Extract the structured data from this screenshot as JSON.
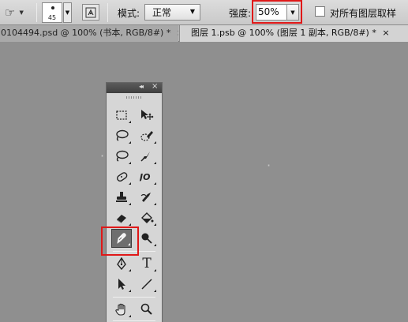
{
  "options_bar": {
    "brush_size": "45",
    "mode_label": "模式:",
    "mode_value": "正常",
    "strength_label": "强度:",
    "strength_value": "50%",
    "sample_all_layers_label": "对所有图层取样",
    "sample_all_layers_checked": false,
    "highlight_color": "#e01818"
  },
  "tabs": [
    {
      "label": "0104494.psd @ 100% (书本, RGB/8#) *",
      "active": false,
      "close": "×"
    },
    {
      "label": "图层 1.psb @ 100% (图层 1 副本, RGB/8#) *",
      "active": true,
      "close": "×"
    }
  ],
  "toolbox": {
    "collapse_glyph": "◂◂",
    "close_glyph": "×",
    "active_tool": "smudge-tool",
    "tools": [
      {
        "name": "marquee-tool",
        "icon": "dashed-rectangle"
      },
      {
        "name": "move-tool",
        "icon": "move-arrow"
      },
      {
        "name": "lasso-tool",
        "icon": "lasso"
      },
      {
        "name": "quick-selection-tool",
        "icon": "quick-select-brush"
      },
      {
        "name": "lasso-tool-2",
        "icon": "lasso"
      },
      {
        "name": "crop-tool",
        "icon": "crop"
      },
      {
        "name": "spot-healing-brush-tool",
        "icon": "bandage"
      },
      {
        "name": "brush-tool",
        "icon": "brush"
      },
      {
        "name": "clone-stamp-tool",
        "icon": "stamp"
      },
      {
        "name": "history-brush-tool",
        "icon": "history-brush"
      },
      {
        "name": "eraser-tool",
        "icon": "eraser"
      },
      {
        "name": "paint-bucket-tool",
        "icon": "bucket"
      },
      {
        "name": "smudge-tool",
        "icon": "finger"
      },
      {
        "name": "dodge-tool",
        "icon": "dodge"
      },
      {
        "name": "pen-tool",
        "icon": "pen"
      },
      {
        "name": "type-tool",
        "icon": "type",
        "glyph": "T"
      },
      {
        "name": "path-selection-tool",
        "icon": "arrow"
      },
      {
        "name": "line-tool",
        "icon": "line"
      },
      {
        "name": "hand-tool",
        "icon": "hand"
      },
      {
        "name": "zoom-tool",
        "icon": "magnifier"
      }
    ]
  }
}
